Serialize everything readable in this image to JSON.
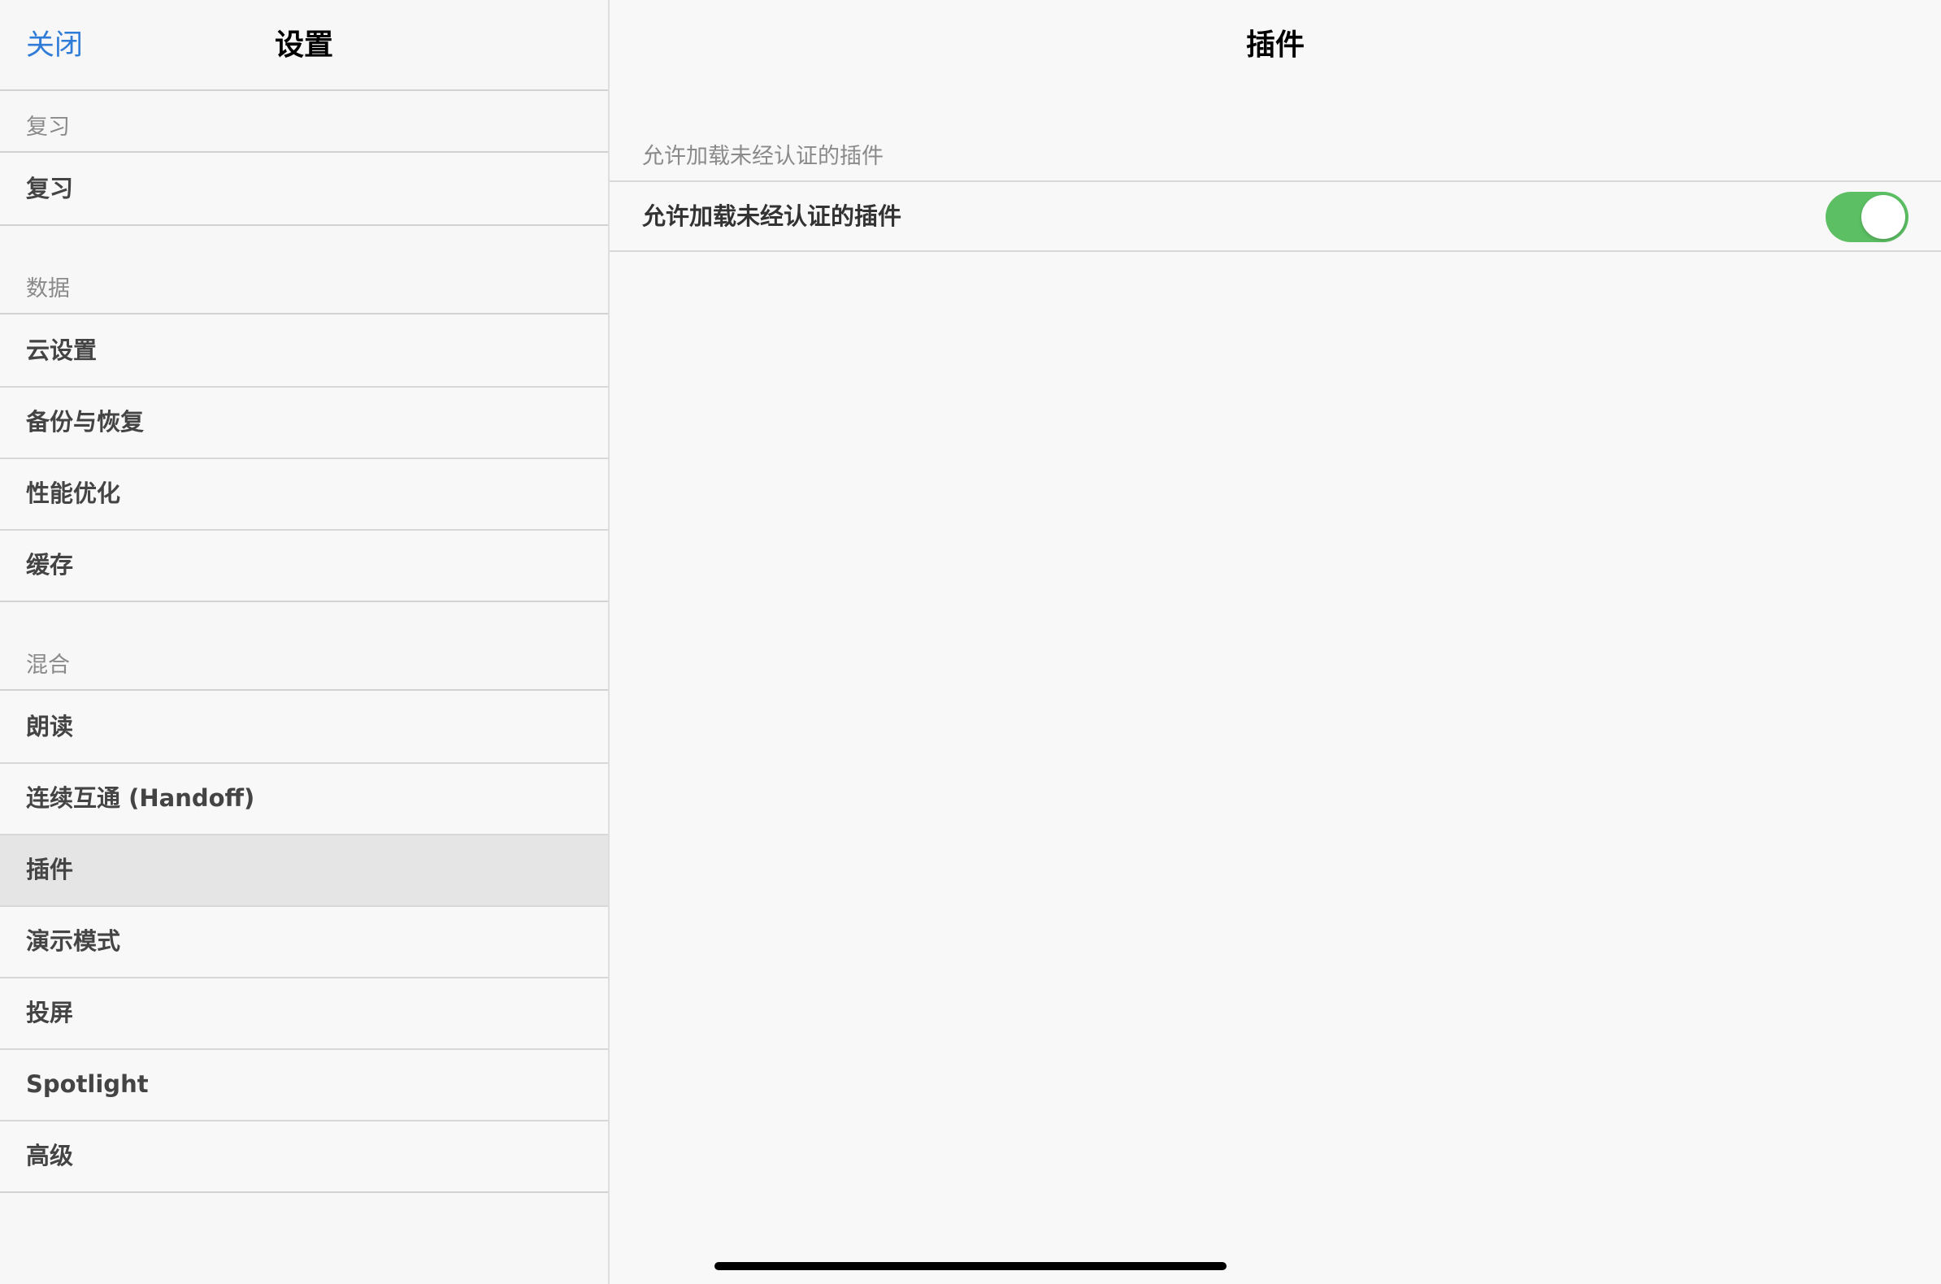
{
  "sidebar": {
    "close_label": "关闭",
    "title": "设置",
    "sections": [
      {
        "header": "复习",
        "items": [
          {
            "label": "复习"
          }
        ]
      },
      {
        "header": "数据",
        "items": [
          {
            "label": "云设置"
          },
          {
            "label": "备份与恢复"
          },
          {
            "label": "性能优化"
          },
          {
            "label": "缓存"
          }
        ]
      },
      {
        "header": "混合",
        "items": [
          {
            "label": "朗读"
          },
          {
            "label": "连续互通 (Handoff)"
          },
          {
            "label": "插件",
            "selected": true
          },
          {
            "label": "演示模式"
          },
          {
            "label": "投屏"
          },
          {
            "label": "Spotlight"
          },
          {
            "label": "高级"
          }
        ]
      }
    ]
  },
  "detail": {
    "title": "插件",
    "section_header": "允许加载未经认证的插件",
    "row_label": "允许加载未经认证的插件",
    "toggle_on": true
  },
  "colors": {
    "accent": "#2f7bd8",
    "toggle_on": "#5cbf63",
    "selected_row": "#e5e5e5"
  }
}
